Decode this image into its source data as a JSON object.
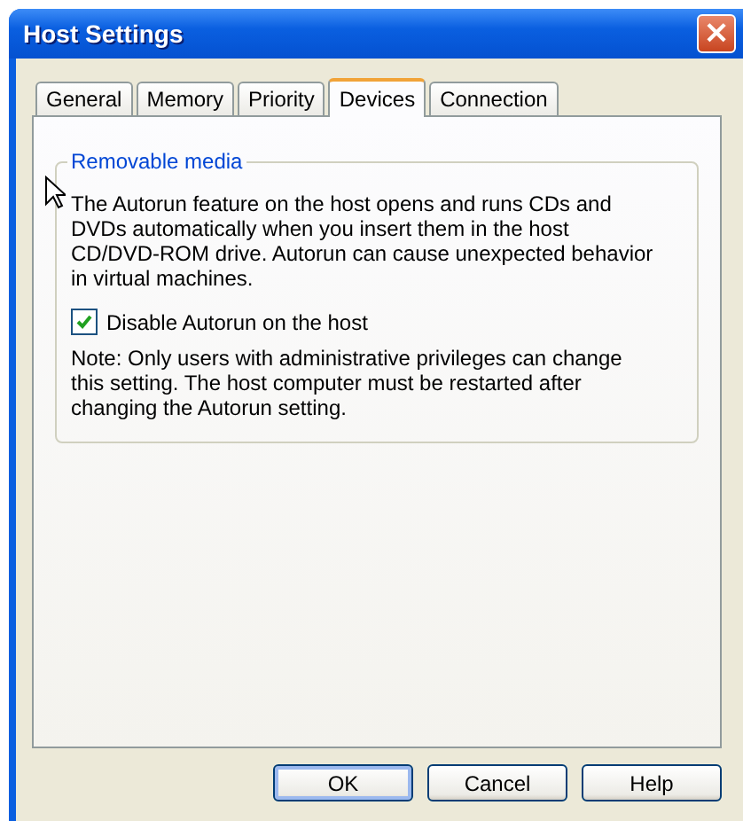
{
  "window": {
    "title": "Host Settings",
    "close": "×"
  },
  "tabs": [
    {
      "label": "General",
      "selected": false
    },
    {
      "label": "Memory",
      "selected": false
    },
    {
      "label": "Priority",
      "selected": false
    },
    {
      "label": "Devices",
      "selected": true
    },
    {
      "label": "Connection",
      "selected": false
    }
  ],
  "group": {
    "title": "Removable media",
    "description": "The Autorun feature on the host opens and runs CDs and DVDs automatically when you insert them in the host CD/DVD-ROM drive.  Autorun can cause unexpected behavior in virtual machines.",
    "checkbox": {
      "label": "Disable Autorun on the host",
      "checked": true
    },
    "note": "Note:  Only users with administrative privileges can change this setting.  The host computer must be restarted after changing the Autorun setting."
  },
  "buttons": [
    {
      "label": "OK",
      "default": true
    },
    {
      "label": "Cancel",
      "default": false
    },
    {
      "label": "Help",
      "default": false
    }
  ]
}
